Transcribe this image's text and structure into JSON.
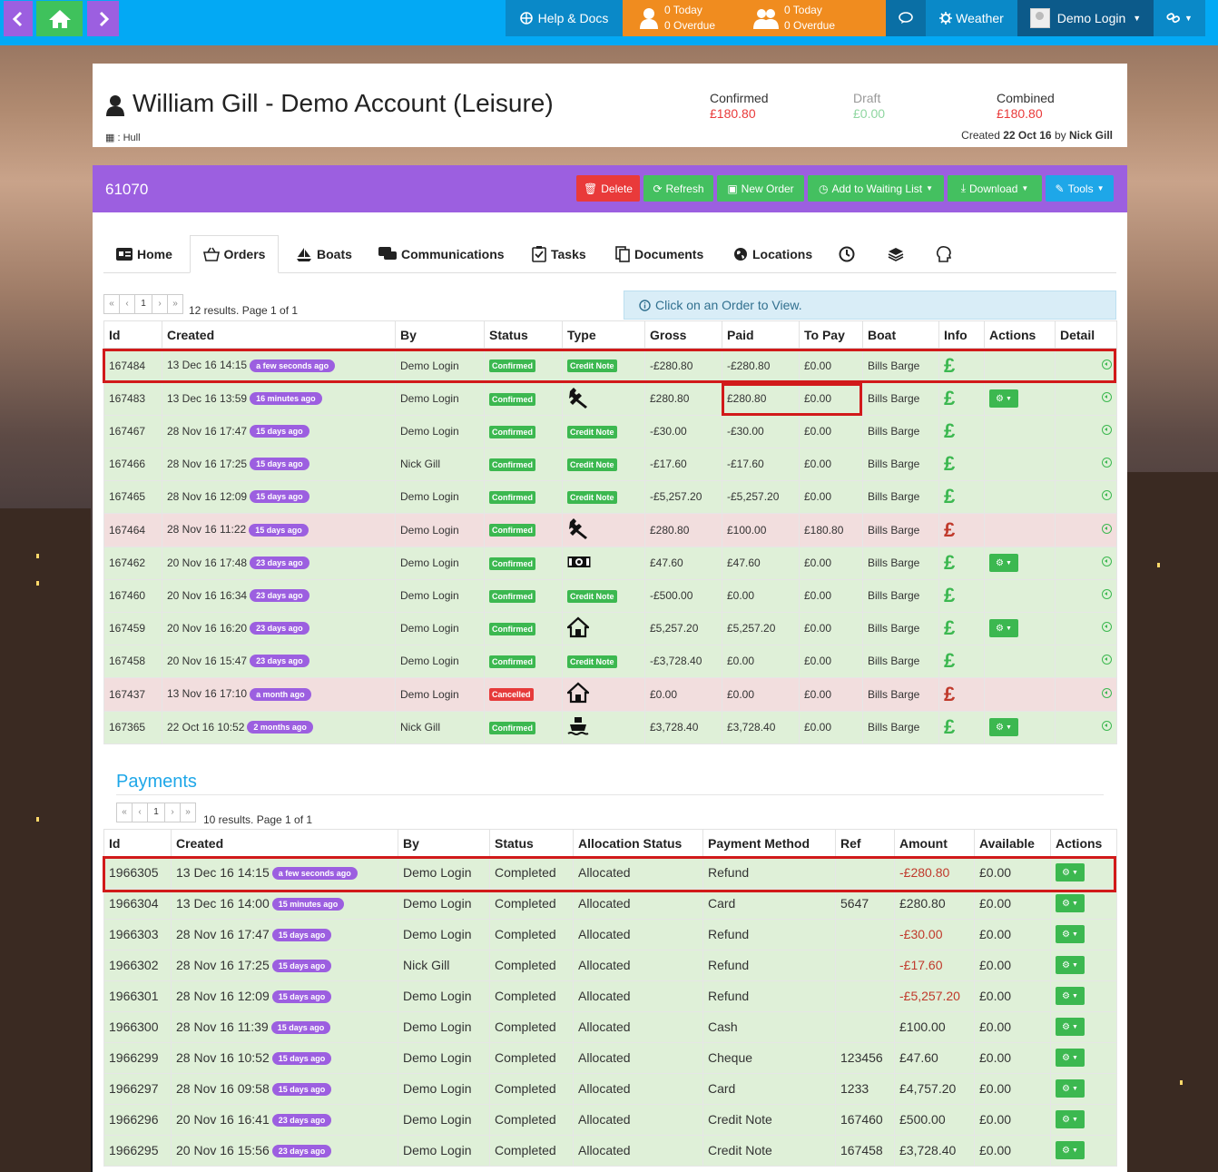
{
  "topnav": {
    "help_label": "Help & Docs",
    "todo1": {
      "today": "0 Today",
      "overdue": "0 Overdue"
    },
    "todo2": {
      "today": "0 Today",
      "overdue": "0 Overdue"
    },
    "weather_label": "Weather",
    "user_label": "Demo Login"
  },
  "account": {
    "title": "William Gill - Demo Account (Leisure)",
    "location": ": Hull",
    "confirmed_label": "Confirmed",
    "confirmed_value": "£180.80",
    "draft_label": "Draft",
    "draft_value": "£0.00",
    "combined_label": "Combined",
    "combined_value": "£180.80",
    "created_prefix": "Created",
    "created_date": "22 Oct 16",
    "created_by_word": "by",
    "created_by": "Nick Gill"
  },
  "panel": {
    "id": "61070",
    "buttons": {
      "delete": "Delete",
      "refresh": "Refresh",
      "new_order": "New Order",
      "waiting": "Add to Waiting List",
      "download": "Download",
      "tools": "Tools"
    }
  },
  "tabs": [
    "Home",
    "Orders",
    "Boats",
    "Communications",
    "Tasks",
    "Documents",
    "Locations"
  ],
  "orders": {
    "pager_page": "1",
    "results_text": "12 results. Page 1 of 1",
    "info_text": "Click on an Order to View.",
    "headers": [
      "Id",
      "Created",
      "By",
      "Status",
      "Type",
      "Gross",
      "Paid",
      "To Pay",
      "Boat",
      "Info",
      "Actions",
      "Detail"
    ],
    "rows": [
      {
        "id": "167484",
        "created": "13 Dec 16 14:15",
        "ago": "a few seconds ago",
        "by": "Demo Login",
        "status": "Confirmed",
        "type": "Credit Note",
        "gross": "-£280.80",
        "paid": "-£280.80",
        "topay": "£0.00",
        "boat": "Bills Barge",
        "info": "£",
        "action": false,
        "tone": "g"
      },
      {
        "id": "167483",
        "created": "13 Dec 16 13:59",
        "ago": "16 minutes ago",
        "by": "Demo Login",
        "status": "Confirmed",
        "type": "wrench",
        "gross": "£280.80",
        "paid": "£280.80",
        "topay": "£0.00",
        "boat": "Bills Barge",
        "info": "£",
        "action": true,
        "tone": "g"
      },
      {
        "id": "167467",
        "created": "28 Nov 16 17:47",
        "ago": "15 days ago",
        "by": "Demo Login",
        "status": "Confirmed",
        "type": "Credit Note",
        "gross": "-£30.00",
        "paid": "-£30.00",
        "topay": "£0.00",
        "boat": "Bills Barge",
        "info": "£",
        "action": false,
        "tone": "g"
      },
      {
        "id": "167466",
        "created": "28 Nov 16 17:25",
        "ago": "15 days ago",
        "by": "Nick Gill",
        "status": "Confirmed",
        "type": "Credit Note",
        "gross": "-£17.60",
        "paid": "-£17.60",
        "topay": "£0.00",
        "boat": "Bills Barge",
        "info": "£",
        "action": false,
        "tone": "g"
      },
      {
        "id": "167465",
        "created": "28 Nov 16 12:09",
        "ago": "15 days ago",
        "by": "Demo Login",
        "status": "Confirmed",
        "type": "Credit Note",
        "gross": "-£5,257.20",
        "paid": "-£5,257.20",
        "topay": "£0.00",
        "boat": "Bills Barge",
        "info": "£",
        "action": false,
        "tone": "g"
      },
      {
        "id": "167464",
        "created": "28 Nov 16 11:22",
        "ago": "15 days ago",
        "by": "Demo Login",
        "status": "Confirmed",
        "type": "wrench",
        "gross": "£280.80",
        "paid": "£100.00",
        "topay": "£180.80",
        "boat": "Bills Barge",
        "info": "£",
        "action": false,
        "tone": "r"
      },
      {
        "id": "167462",
        "created": "20 Nov 16 17:48",
        "ago": "23 days ago",
        "by": "Demo Login",
        "status": "Confirmed",
        "type": "money",
        "gross": "£47.60",
        "paid": "£47.60",
        "topay": "£0.00",
        "boat": "Bills Barge",
        "info": "£",
        "action": true,
        "tone": "g"
      },
      {
        "id": "167460",
        "created": "20 Nov 16 16:34",
        "ago": "23 days ago",
        "by": "Demo Login",
        "status": "Confirmed",
        "type": "Credit Note",
        "gross": "-£500.00",
        "paid": "£0.00",
        "topay": "£0.00",
        "boat": "Bills Barge",
        "info": "£",
        "action": false,
        "tone": "g"
      },
      {
        "id": "167459",
        "created": "20 Nov 16 16:20",
        "ago": "23 days ago",
        "by": "Demo Login",
        "status": "Confirmed",
        "type": "house",
        "gross": "£5,257.20",
        "paid": "£5,257.20",
        "topay": "£0.00",
        "boat": "Bills Barge",
        "info": "£",
        "action": true,
        "tone": "g"
      },
      {
        "id": "167458",
        "created": "20 Nov 16 15:47",
        "ago": "23 days ago",
        "by": "Demo Login",
        "status": "Confirmed",
        "type": "Credit Note",
        "gross": "-£3,728.40",
        "paid": "£0.00",
        "topay": "£0.00",
        "boat": "Bills Barge",
        "info": "£",
        "action": false,
        "tone": "g"
      },
      {
        "id": "167437",
        "created": "13 Nov 16 17:10",
        "ago": "a month ago",
        "by": "Demo Login",
        "status": "Cancelled",
        "type": "house",
        "gross": "£0.00",
        "paid": "£0.00",
        "topay": "£0.00",
        "boat": "Bills Barge",
        "info": "£",
        "action": false,
        "tone": "r"
      },
      {
        "id": "167365",
        "created": "22 Oct 16 10:52",
        "ago": "2 months ago",
        "by": "Nick Gill",
        "status": "Confirmed",
        "type": "ship",
        "gross": "£3,728.40",
        "paid": "£3,728.40",
        "topay": "£0.00",
        "boat": "Bills Barge",
        "info": "£",
        "action": true,
        "tone": "g"
      }
    ]
  },
  "payments": {
    "title": "Payments",
    "pager_page": "1",
    "results_text": "10 results. Page 1 of 1",
    "headers": [
      "Id",
      "Created",
      "By",
      "Status",
      "Allocation Status",
      "Payment Method",
      "Ref",
      "Amount",
      "Available",
      "Actions"
    ],
    "rows": [
      {
        "id": "1966305",
        "created": "13 Dec 16 14:15",
        "ago": "a few seconds ago",
        "by": "Demo Login",
        "status": "Completed",
        "alloc": "Allocated",
        "method": "Refund",
        "ref": "",
        "amount": "-£280.80",
        "neg": true,
        "available": "£0.00"
      },
      {
        "id": "1966304",
        "created": "13 Dec 16 14:00",
        "ago": "15 minutes ago",
        "by": "Demo Login",
        "status": "Completed",
        "alloc": "Allocated",
        "method": "Card",
        "ref": "5647",
        "amount": "£280.80",
        "neg": false,
        "available": "£0.00"
      },
      {
        "id": "1966303",
        "created": "28 Nov 16 17:47",
        "ago": "15 days ago",
        "by": "Demo Login",
        "status": "Completed",
        "alloc": "Allocated",
        "method": "Refund",
        "ref": "",
        "amount": "-£30.00",
        "neg": true,
        "available": "£0.00"
      },
      {
        "id": "1966302",
        "created": "28 Nov 16 17:25",
        "ago": "15 days ago",
        "by": "Nick Gill",
        "status": "Completed",
        "alloc": "Allocated",
        "method": "Refund",
        "ref": "",
        "amount": "-£17.60",
        "neg": true,
        "available": "£0.00"
      },
      {
        "id": "1966301",
        "created": "28 Nov 16 12:09",
        "ago": "15 days ago",
        "by": "Demo Login",
        "status": "Completed",
        "alloc": "Allocated",
        "method": "Refund",
        "ref": "",
        "amount": "-£5,257.20",
        "neg": true,
        "available": "£0.00"
      },
      {
        "id": "1966300",
        "created": "28 Nov 16 11:39",
        "ago": "15 days ago",
        "by": "Demo Login",
        "status": "Completed",
        "alloc": "Allocated",
        "method": "Cash",
        "ref": "",
        "amount": "£100.00",
        "neg": false,
        "available": "£0.00"
      },
      {
        "id": "1966299",
        "created": "28 Nov 16 10:52",
        "ago": "15 days ago",
        "by": "Demo Login",
        "status": "Completed",
        "alloc": "Allocated",
        "method": "Cheque",
        "ref": "123456",
        "amount": "£47.60",
        "neg": false,
        "available": "£0.00"
      },
      {
        "id": "1966297",
        "created": "28 Nov 16 09:58",
        "ago": "15 days ago",
        "by": "Demo Login",
        "status": "Completed",
        "alloc": "Allocated",
        "method": "Card",
        "ref": "1233",
        "amount": "£4,757.20",
        "neg": false,
        "available": "£0.00"
      },
      {
        "id": "1966296",
        "created": "20 Nov 16 16:41",
        "ago": "23 days ago",
        "by": "Demo Login",
        "status": "Completed",
        "alloc": "Allocated",
        "method": "Credit Note",
        "ref": "167460",
        "amount": "£500.00",
        "neg": false,
        "available": "£0.00"
      },
      {
        "id": "1966295",
        "created": "20 Nov 16 15:56",
        "ago": "23 days ago",
        "by": "Demo Login",
        "status": "Completed",
        "alloc": "Allocated",
        "method": "Credit Note",
        "ref": "167458",
        "amount": "£3,728.40",
        "neg": false,
        "available": "£0.00"
      }
    ]
  },
  "colors": {
    "purple": "#9c5fe0",
    "green": "#3cb850",
    "blue": "#03a9f4",
    "orange": "#f08c1f",
    "red": "#e93a3a"
  }
}
